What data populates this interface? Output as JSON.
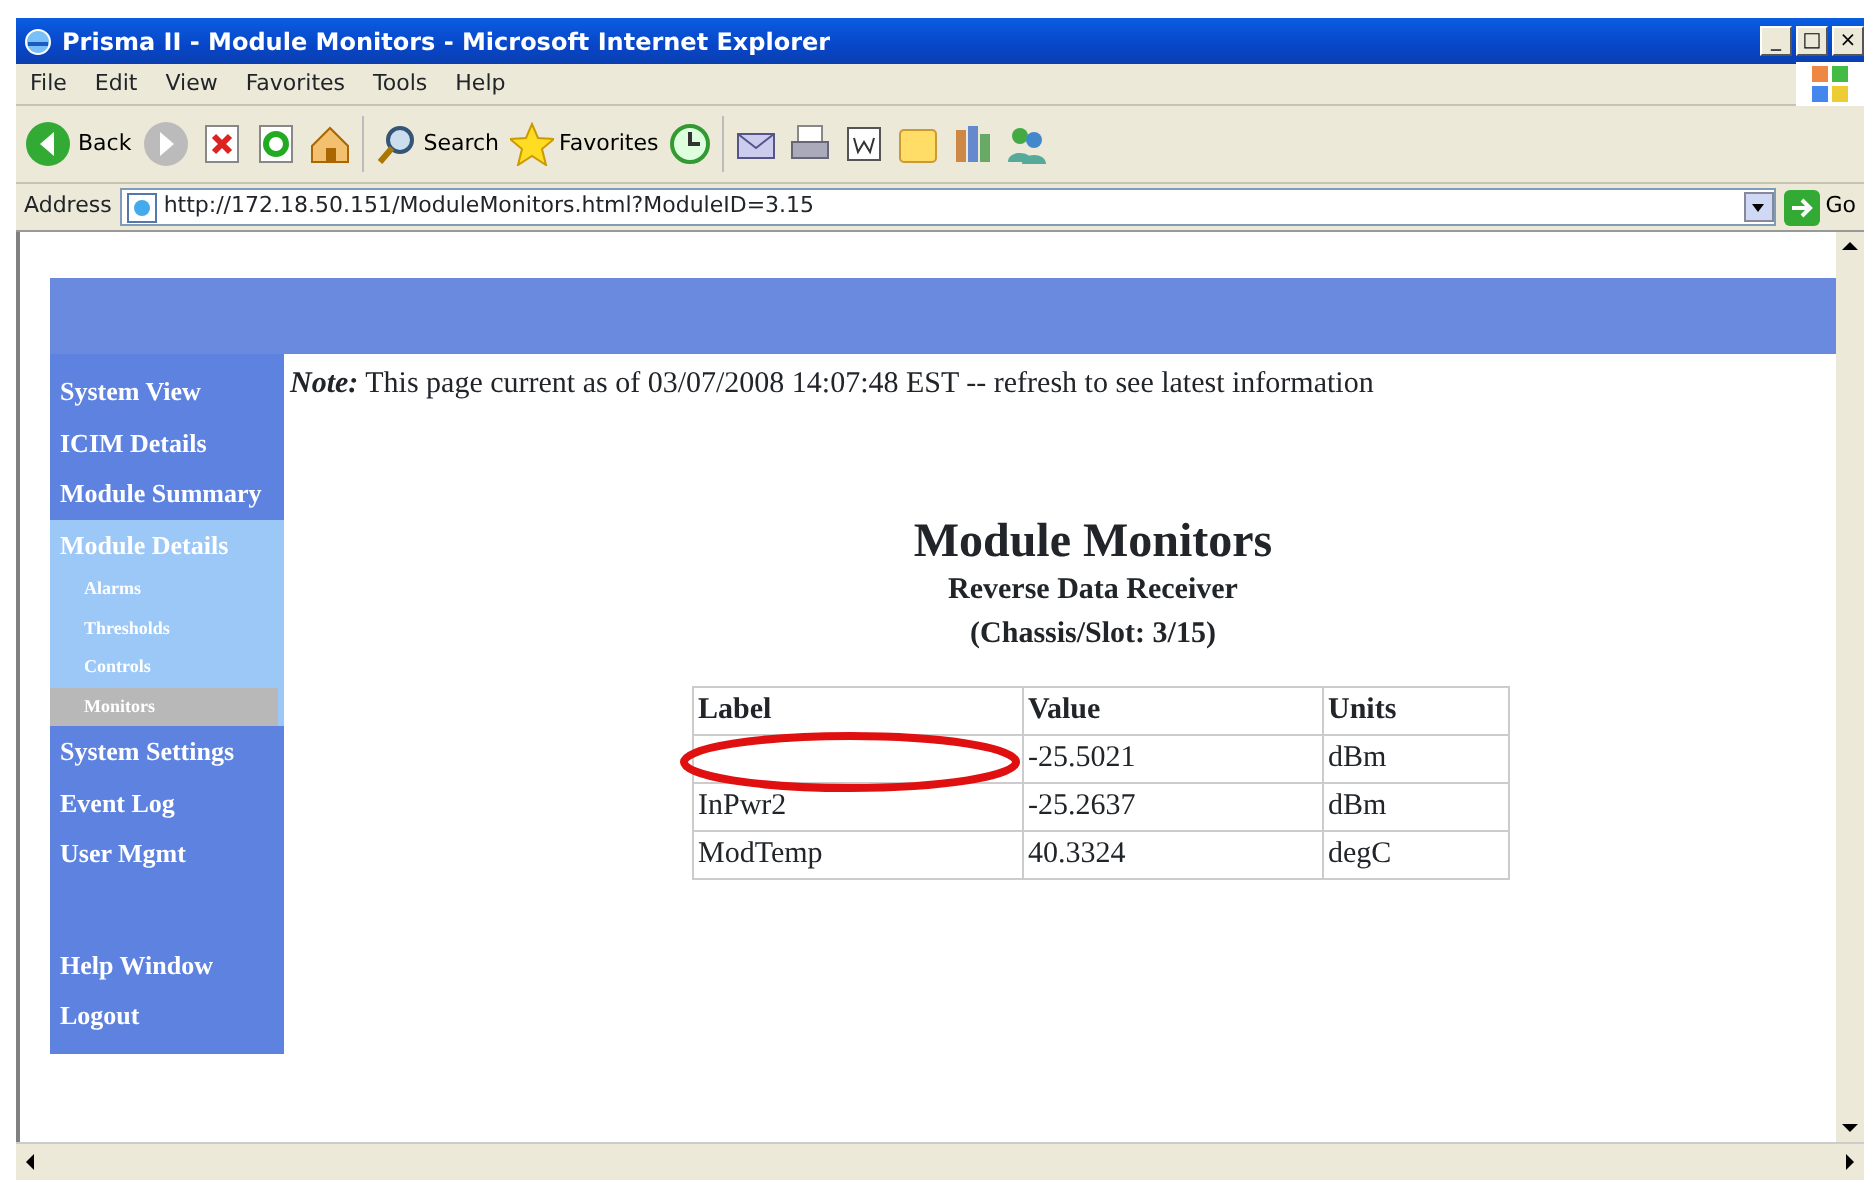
{
  "window": {
    "title": "Prisma II - Module Monitors - Microsoft Internet Explorer",
    "controls": [
      "_",
      "□",
      "×"
    ]
  },
  "menu": [
    "File",
    "Edit",
    "View",
    "Favorites",
    "Tools",
    "Help"
  ],
  "toolbar": [
    {
      "kind": "back",
      "label": "Back"
    },
    {
      "kind": "forward"
    },
    {
      "kind": "stop"
    },
    {
      "kind": "refresh"
    },
    {
      "kind": "home"
    },
    {
      "kind": "sep"
    },
    {
      "kind": "search",
      "label": "Search"
    },
    {
      "kind": "favorites",
      "label": "Favorites"
    },
    {
      "kind": "history"
    },
    {
      "kind": "sep"
    },
    {
      "kind": "mail"
    },
    {
      "kind": "print"
    },
    {
      "kind": "edit"
    },
    {
      "kind": "folder"
    },
    {
      "kind": "research"
    },
    {
      "kind": "messenger"
    }
  ],
  "address": {
    "label": "Address",
    "url": "http://172.18.50.151/ModuleMonitors.html?ModuleID=3.15",
    "go": "Go"
  },
  "sidebar": {
    "sections": [
      [
        {
          "label": "System View"
        },
        {
          "label": "ICIM Details"
        },
        {
          "label": "Module Summary"
        },
        {
          "label": "Module Details",
          "expanded": true,
          "children": [
            {
              "label": "Alarms",
              "selected": false
            },
            {
              "label": "Thresholds",
              "selected": false
            },
            {
              "label": "Controls",
              "selected": false
            },
            {
              "label": "Monitors",
              "selected": true
            }
          ]
        },
        {
          "label": "System Settings"
        },
        {
          "label": "Event Log"
        },
        {
          "label": "User Mgmt"
        }
      ],
      [
        {
          "label": "Help Window"
        },
        {
          "label": "Logout"
        }
      ]
    ]
  },
  "note": {
    "prefix": "Note:",
    "text": "This page current as of 03/07/2008 14:07:48 EST -- refresh to see latest information"
  },
  "heading": {
    "title": "Module Monitors",
    "subtitle": "Reverse Data Receiver",
    "slot": "(Chassis/Slot: 3/15)"
  },
  "table": {
    "columns": [
      "Label",
      "Value",
      "Units"
    ],
    "rows": [
      {
        "value": "-25.5021",
        "units": "dBm"
      },
      {
        "label": "InPwr2",
        "value": "-25.2637",
        "units": "dBm"
      },
      {
        "label": "ModTemp",
        "value": "40.3324",
        "units": "degC"
      }
    ]
  },
  "annotation": {
    "kind": "ellipse",
    "color": "#e01010"
  }
}
